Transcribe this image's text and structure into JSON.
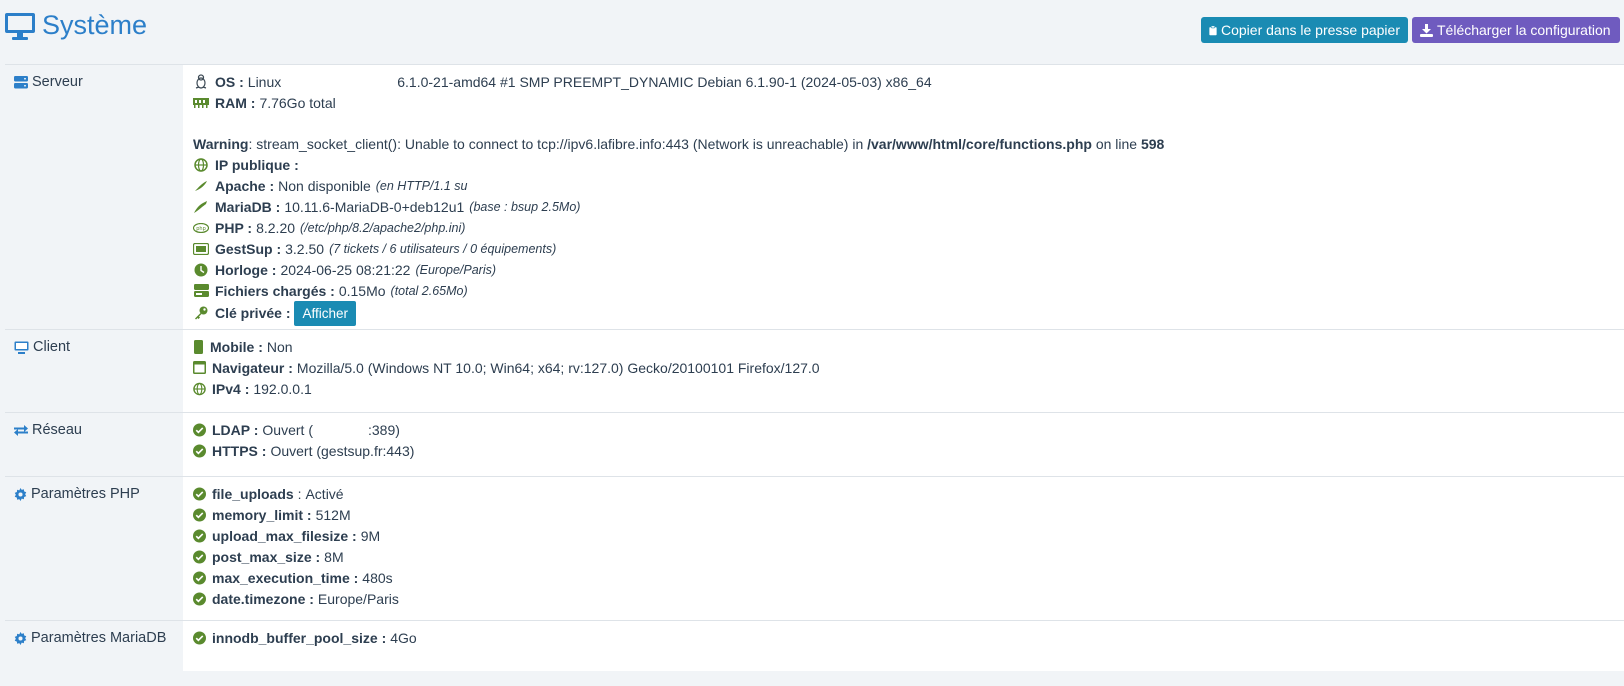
{
  "header": {
    "title": "Système",
    "copy_button": "Copier dans le presse papier",
    "download_button": "Télécharger la configuration"
  },
  "server": {
    "label": "Serveur",
    "os_label": "OS :",
    "os_value": "Linux",
    "os_kernel": "6.1.0-21-amd64 #1 SMP PREEMPT_DYNAMIC Debian 6.1.90-1 (2024-05-03) x86_64",
    "ram_label": "RAM :",
    "ram_value": "7.76Go total",
    "warning_label": "Warning",
    "warning_text": ": stream_socket_client(): Unable to connect to tcp://ipv6.lafibre.info:443 (Network is unreachable) in ",
    "warning_file": "/var/www/html/core/functions.php",
    "warning_on_line": " on line ",
    "warning_line": "598",
    "ip_label": "IP publique :",
    "ip_value": "",
    "apache_label": "Apache :",
    "apache_value": "Non disponible",
    "apache_detail": "(en HTTP/1.1 su",
    "mariadb_label": "MariaDB :",
    "mariadb_value": "10.11.6-MariaDB-0+deb12u1",
    "mariadb_detail": "(base : bsup 2.5Mo)",
    "php_label": "PHP :",
    "php_value": "8.2.20",
    "php_detail": "(/etc/php/8.2/apache2/php.ini)",
    "gestsup_label": "GestSup :",
    "gestsup_value": "3.2.50",
    "gestsup_detail": "(7 tickets / 6 utilisateurs / 0 équipements)",
    "clock_label": "Horloge :",
    "clock_value": "2024-06-25 08:21:22",
    "clock_detail": "(Europe/Paris)",
    "files_label": "Fichiers chargés :",
    "files_value": "0.15Mo",
    "files_detail": "(total 2.65Mo)",
    "key_label": "Clé privée :",
    "key_button": "Afficher"
  },
  "client": {
    "label": "Client",
    "mobile_label": "Mobile :",
    "mobile_value": "Non",
    "browser_label": "Navigateur :",
    "browser_value": "Mozilla/5.0 (Windows NT 10.0; Win64; x64; rv:127.0) Gecko/20100101 Firefox/127.0",
    "ipv4_label": "IPv4 :",
    "ipv4_value": "192.0.0.1"
  },
  "network": {
    "label": "Réseau",
    "ldap_label": "LDAP :",
    "ldap_value": "Ouvert (",
    "ldap_port": ":389)",
    "https_label": "HTTPS :",
    "https_value": "Ouvert (gestsup.fr:443)"
  },
  "php_params": {
    "label": "Paramètres PHP",
    "items": [
      {
        "name": "file_uploads",
        "sep": " :",
        "value": "Activé"
      },
      {
        "name": "memory_limit :",
        "sep": "",
        "value": "512M"
      },
      {
        "name": "upload_max_filesize :",
        "sep": "",
        "value": "9M"
      },
      {
        "name": "post_max_size :",
        "sep": "",
        "value": "8M"
      },
      {
        "name": "max_execution_time :",
        "sep": "",
        "value": "480s"
      },
      {
        "name": "date.timezone :",
        "sep": "",
        "value": "Europe/Paris"
      }
    ]
  },
  "mariadb_params": {
    "label": "Paramètres MariaDB",
    "items": [
      {
        "name": "innodb_buffer_pool_size :",
        "value": "4Go"
      }
    ]
  },
  "colors": {
    "accent_blue": "#2c7fc9",
    "copy_button": "#1a8bb3",
    "download_button": "#6f5bbf",
    "ok_green": "#5a8a2e"
  }
}
